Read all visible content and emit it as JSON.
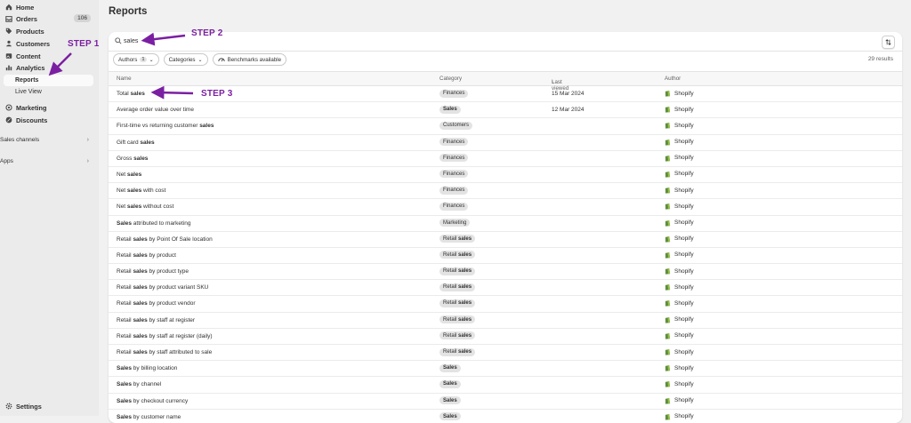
{
  "sidebar": {
    "items": [
      {
        "label": "Home",
        "icon": "home-icon"
      },
      {
        "label": "Orders",
        "icon": "inbox-icon",
        "count": "106"
      },
      {
        "label": "Products",
        "icon": "tag-icon"
      },
      {
        "label": "Customers",
        "icon": "person-icon"
      },
      {
        "label": "Content",
        "icon": "content-icon"
      },
      {
        "label": "Analytics",
        "icon": "chart-icon"
      }
    ],
    "subitems": [
      {
        "label": "Reports",
        "active": true
      },
      {
        "label": "Live View",
        "active": false
      }
    ],
    "items2": [
      {
        "label": "Marketing",
        "icon": "target-icon"
      },
      {
        "label": "Discounts",
        "icon": "discount-icon"
      }
    ],
    "sales_channels": "Sales channels",
    "apps": "Apps",
    "settings": "Settings"
  },
  "page": {
    "title": "Reports",
    "search_value": "sales",
    "filters": {
      "authors": "Authors",
      "authors_count": "1",
      "categories": "Categories",
      "benchmarks": "Benchmarks available"
    },
    "results": "29 results",
    "columns": {
      "name": "Name",
      "category": "Category",
      "last_viewed": "Last viewed",
      "author": "Author"
    }
  },
  "rows": [
    {
      "pre": "Total ",
      "bold": "sales",
      "post": "",
      "cat_pre": "Finances",
      "cat_bold": "",
      "date": "15 Mar 2024",
      "author": "Shopify"
    },
    {
      "pre": "Average order value over time",
      "bold": "",
      "post": "",
      "cat_pre": "",
      "cat_bold": "Sales",
      "date": "12 Mar 2024",
      "author": "Shopify"
    },
    {
      "pre": "First-time vs returning customer ",
      "bold": "sales",
      "post": "",
      "cat_pre": "Customers",
      "cat_bold": "",
      "date": "",
      "author": "Shopify"
    },
    {
      "pre": "Gift card ",
      "bold": "sales",
      "post": "",
      "cat_pre": "Finances",
      "cat_bold": "",
      "date": "",
      "author": "Shopify"
    },
    {
      "pre": "Gross ",
      "bold": "sales",
      "post": "",
      "cat_pre": "Finances",
      "cat_bold": "",
      "date": "",
      "author": "Shopify"
    },
    {
      "pre": "Net ",
      "bold": "sales",
      "post": "",
      "cat_pre": "Finances",
      "cat_bold": "",
      "date": "",
      "author": "Shopify"
    },
    {
      "pre": "Net ",
      "bold": "sales",
      "post": " with cost",
      "cat_pre": "Finances",
      "cat_bold": "",
      "date": "",
      "author": "Shopify"
    },
    {
      "pre": "Net ",
      "bold": "sales",
      "post": " without cost",
      "cat_pre": "Finances",
      "cat_bold": "",
      "date": "",
      "author": "Shopify"
    },
    {
      "pre": "",
      "bold": "Sales",
      "post": " attributed to marketing",
      "cat_pre": "Marketing",
      "cat_bold": "",
      "date": "",
      "author": "Shopify"
    },
    {
      "pre": "Retail ",
      "bold": "sales",
      "post": " by Point Of Sale location",
      "cat_pre": "Retail ",
      "cat_bold": "sales",
      "date": "",
      "author": "Shopify"
    },
    {
      "pre": "Retail ",
      "bold": "sales",
      "post": " by product",
      "cat_pre": "Retail ",
      "cat_bold": "sales",
      "date": "",
      "author": "Shopify"
    },
    {
      "pre": "Retail ",
      "bold": "sales",
      "post": " by product type",
      "cat_pre": "Retail ",
      "cat_bold": "sales",
      "date": "",
      "author": "Shopify"
    },
    {
      "pre": "Retail ",
      "bold": "sales",
      "post": " by product variant SKU",
      "cat_pre": "Retail ",
      "cat_bold": "sales",
      "date": "",
      "author": "Shopify"
    },
    {
      "pre": "Retail ",
      "bold": "sales",
      "post": " by product vendor",
      "cat_pre": "Retail ",
      "cat_bold": "sales",
      "date": "",
      "author": "Shopify"
    },
    {
      "pre": "Retail ",
      "bold": "sales",
      "post": " by staff at register",
      "cat_pre": "Retail ",
      "cat_bold": "sales",
      "date": "",
      "author": "Shopify"
    },
    {
      "pre": "Retail ",
      "bold": "sales",
      "post": " by staff at register (daily)",
      "cat_pre": "Retail ",
      "cat_bold": "sales",
      "date": "",
      "author": "Shopify"
    },
    {
      "pre": "Retail ",
      "bold": "sales",
      "post": " by staff attributed to sale",
      "cat_pre": "Retail ",
      "cat_bold": "sales",
      "date": "",
      "author": "Shopify"
    },
    {
      "pre": "",
      "bold": "Sales",
      "post": " by billing location",
      "cat_pre": "",
      "cat_bold": "Sales",
      "date": "",
      "author": "Shopify"
    },
    {
      "pre": "",
      "bold": "Sales",
      "post": " by channel",
      "cat_pre": "",
      "cat_bold": "Sales",
      "date": "",
      "author": "Shopify"
    },
    {
      "pre": "",
      "bold": "Sales",
      "post": " by checkout currency",
      "cat_pre": "",
      "cat_bold": "Sales",
      "date": "",
      "author": "Shopify"
    },
    {
      "pre": "",
      "bold": "Sales",
      "post": " by customer name",
      "cat_pre": "",
      "cat_bold": "Sales",
      "date": "",
      "author": "Shopify"
    }
  ],
  "annotations": {
    "step1": "STEP 1",
    "step2": "STEP 2",
    "step3": "STEP 3",
    "color": "#7b1fa2"
  }
}
